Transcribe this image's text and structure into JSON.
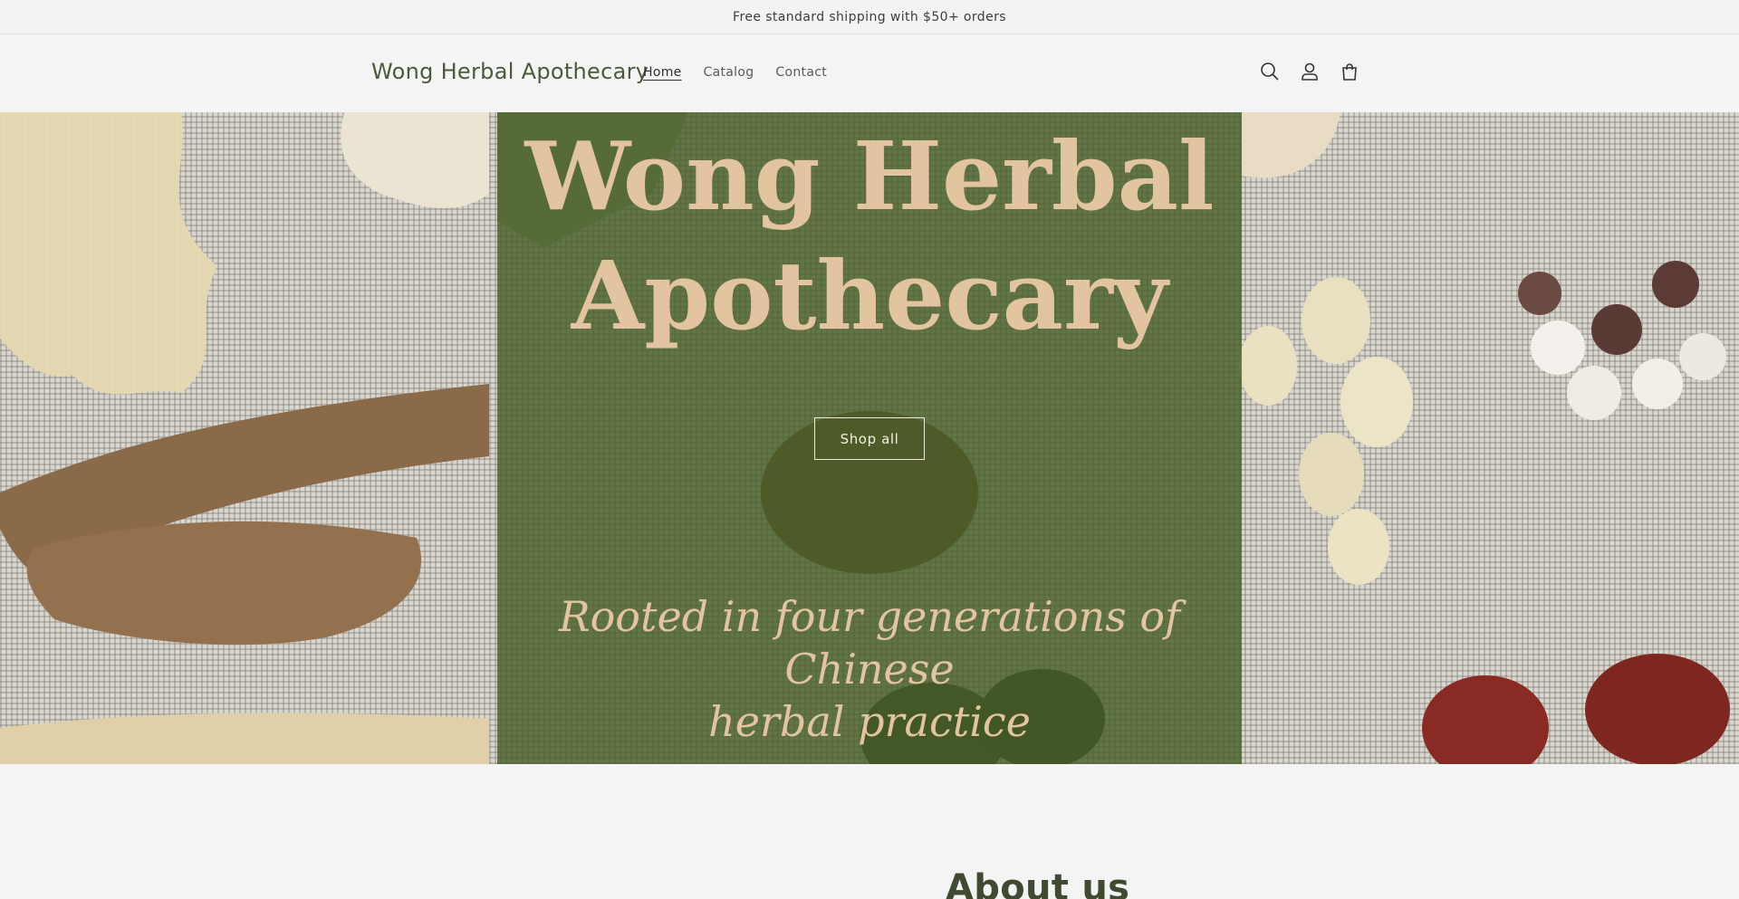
{
  "announcement": {
    "text": "Free standard shipping with $50+ orders"
  },
  "header": {
    "logo": "Wong Herbal Apothecary",
    "nav": [
      {
        "label": "Home",
        "active": true
      },
      {
        "label": "Catalog",
        "active": false
      },
      {
        "label": "Contact",
        "active": false
      }
    ],
    "icons": [
      "search-icon",
      "account-icon",
      "cart-icon"
    ]
  },
  "hero": {
    "title_line1": "Wong Herbal",
    "title_line2": "Apothecary",
    "button_label": "Shop all",
    "subtitle_line1": "Rooted in four generations of Chinese",
    "subtitle_line2": "herbal practice"
  },
  "about": {
    "title": "About us"
  },
  "colors": {
    "overlay": "#485f28",
    "title": "#e2c4a0",
    "background": "#f4f4f4",
    "logo": "#4b5a3c"
  }
}
